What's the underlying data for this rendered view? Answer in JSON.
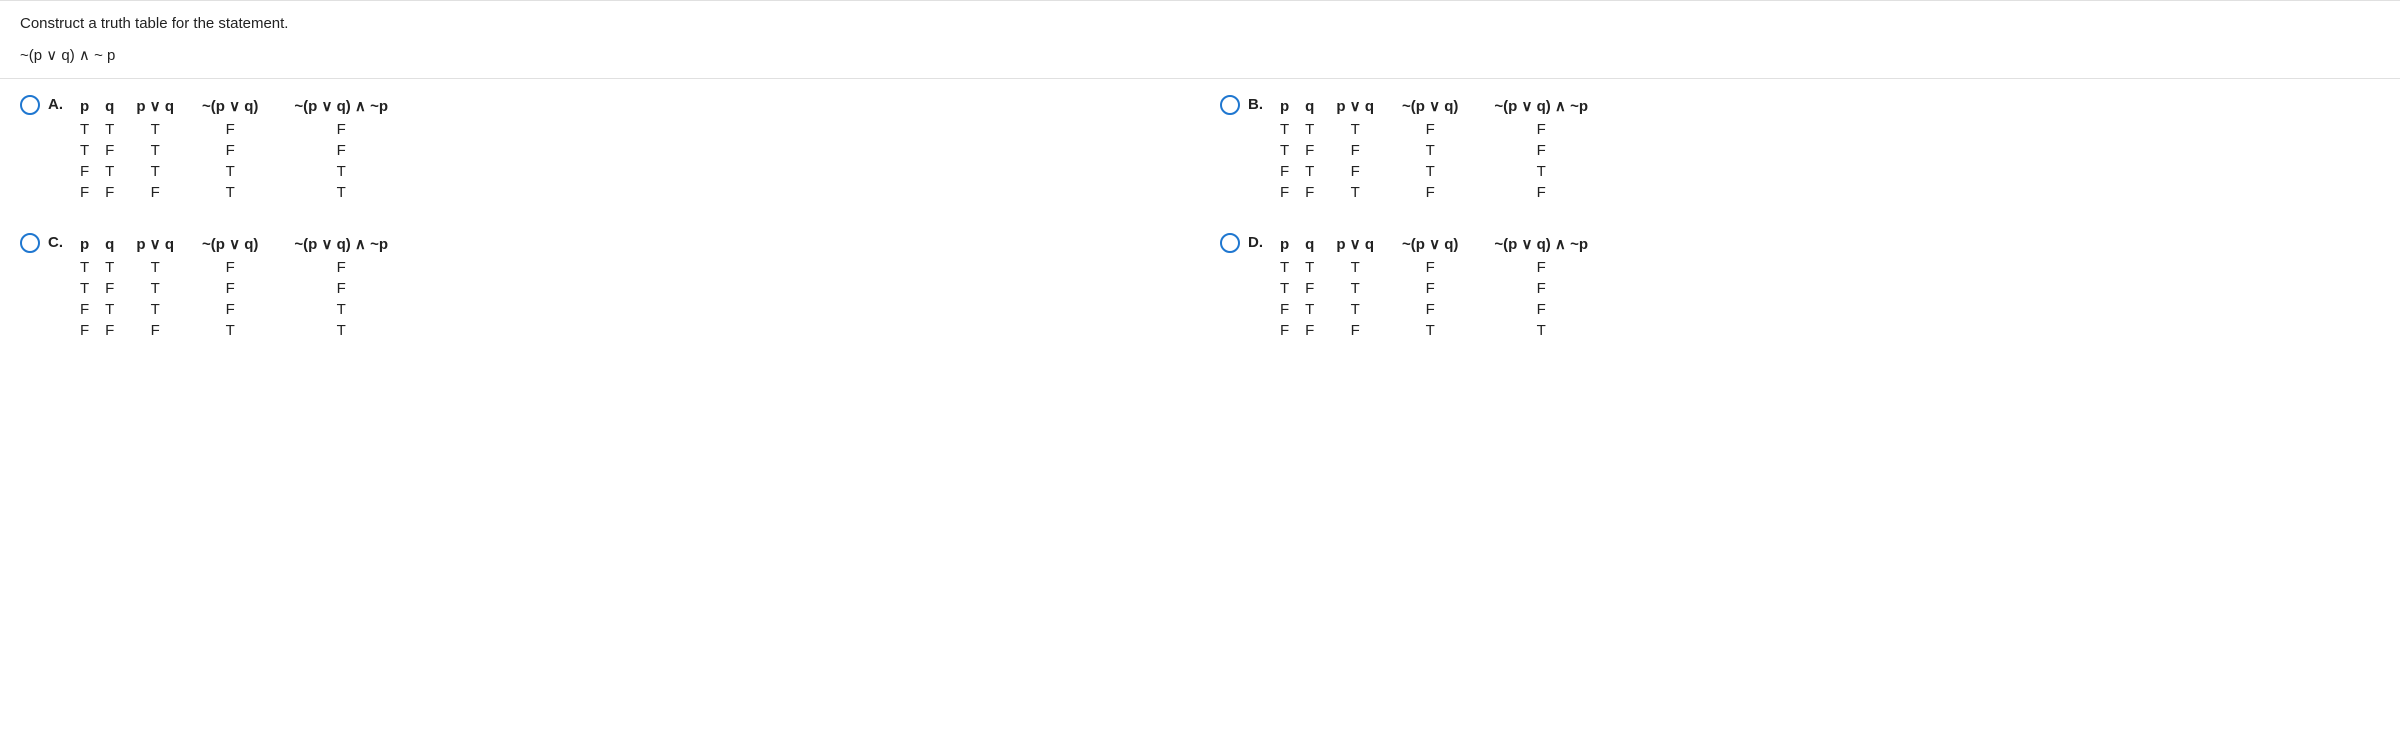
{
  "prompt": "Construct a truth table for the statement.",
  "expression": "~(p ∨ q) ∧ ~ p",
  "headers": {
    "p": "p",
    "q": "q",
    "pvq": "p ∨ q",
    "npvq": "~(p ∨ q)",
    "full": "~(p ∨ q) ∧ ~p"
  },
  "options": {
    "A": {
      "label": "A.",
      "rows": [
        [
          "T",
          "T",
          "T",
          "F",
          "F"
        ],
        [
          "T",
          "F",
          "T",
          "F",
          "F"
        ],
        [
          "F",
          "T",
          "T",
          "T",
          "T"
        ],
        [
          "F",
          "F",
          "F",
          "T",
          "T"
        ]
      ]
    },
    "B": {
      "label": "B.",
      "rows": [
        [
          "T",
          "T",
          "T",
          "F",
          "F"
        ],
        [
          "T",
          "F",
          "F",
          "T",
          "F"
        ],
        [
          "F",
          "T",
          "F",
          "T",
          "T"
        ],
        [
          "F",
          "F",
          "T",
          "F",
          "F"
        ]
      ]
    },
    "C": {
      "label": "C.",
      "rows": [
        [
          "T",
          "T",
          "T",
          "F",
          "F"
        ],
        [
          "T",
          "F",
          "T",
          "F",
          "F"
        ],
        [
          "F",
          "T",
          "T",
          "F",
          "T"
        ],
        [
          "F",
          "F",
          "F",
          "T",
          "T"
        ]
      ]
    },
    "D": {
      "label": "D.",
      "rows": [
        [
          "T",
          "T",
          "T",
          "F",
          "F"
        ],
        [
          "T",
          "F",
          "T",
          "F",
          "F"
        ],
        [
          "F",
          "T",
          "T",
          "F",
          "F"
        ],
        [
          "F",
          "F",
          "F",
          "T",
          "T"
        ]
      ]
    }
  }
}
